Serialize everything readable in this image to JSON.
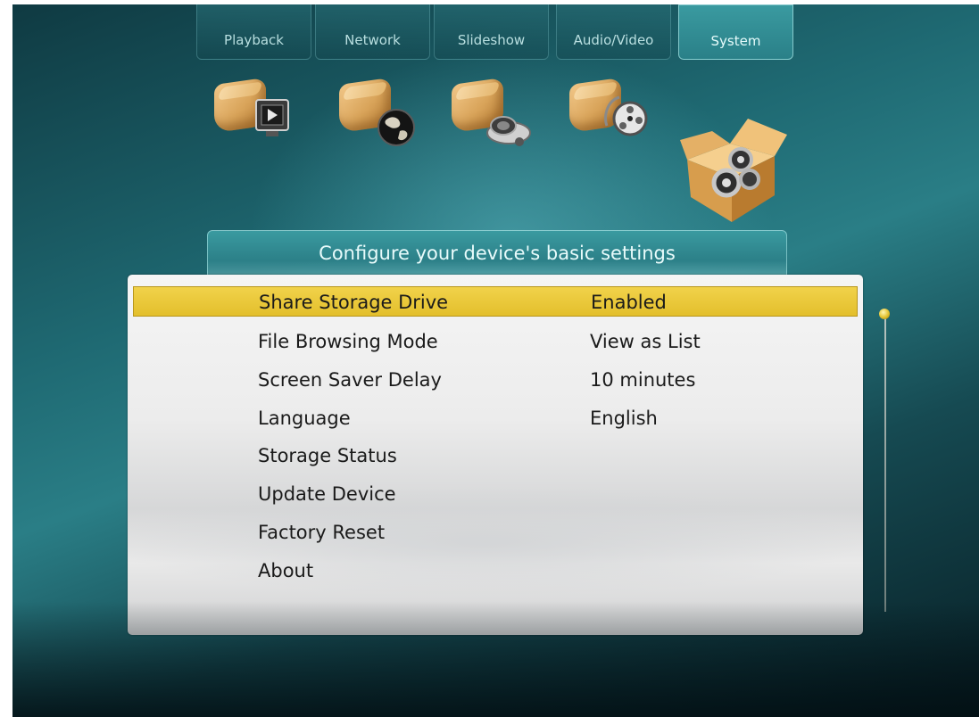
{
  "tabs": [
    {
      "label": "Playback",
      "icon": "playback-box-icon",
      "active": false
    },
    {
      "label": "Network",
      "icon": "network-globe-box-icon",
      "active": false
    },
    {
      "label": "Slideshow",
      "icon": "projector-box-icon",
      "active": false
    },
    {
      "label": "Audio/Video",
      "icon": "film-reel-box-icon",
      "active": false
    },
    {
      "label": "System",
      "icon": "gears-box-icon",
      "active": true
    }
  ],
  "panel": {
    "header": "Configure your device's basic settings",
    "settings": [
      {
        "label": "Share Storage Drive",
        "value": "Enabled",
        "selected": true
      },
      {
        "label": "File Browsing Mode",
        "value": "View as List",
        "selected": false
      },
      {
        "label": "Screen Saver Delay",
        "value": "10 minutes",
        "selected": false
      },
      {
        "label": "Language",
        "value": "English",
        "selected": false
      },
      {
        "label": "Storage Status",
        "value": "",
        "selected": false
      },
      {
        "label": "Update Device",
        "value": "",
        "selected": false
      },
      {
        "label": "Factory Reset",
        "value": "",
        "selected": false
      },
      {
        "label": "About",
        "value": "",
        "selected": false
      }
    ]
  },
  "scroll": {
    "position_fraction": 0.0
  },
  "colors": {
    "background": "#1f6a73",
    "highlight": "#e9c83a",
    "panel": "#ececec",
    "tab_active": "#3a9aa0"
  }
}
